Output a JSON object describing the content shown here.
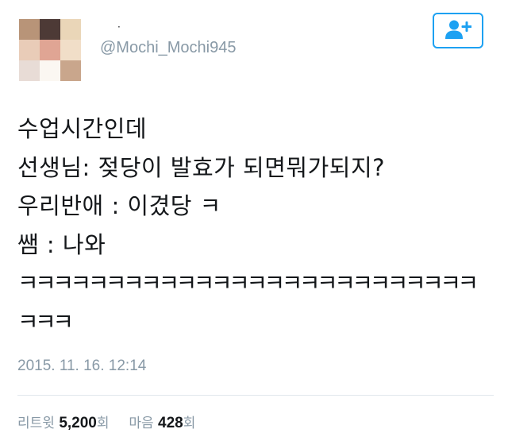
{
  "author": {
    "display_name": "·",
    "handle": "@Mochi_Mochi945",
    "avatar_colors": [
      "#b89478",
      "#4d3a36",
      "#ead6b8",
      "#e9ccb8",
      "#e0a594",
      "#f1dec8",
      "#e8dcd6",
      "#fbf7f2",
      "#c9a68c"
    ]
  },
  "follow_button": {
    "icon": "follow-user-plus-icon",
    "color": "#1da1f2"
  },
  "tweet": {
    "lines": [
      "수업시간인데",
      "선생님: 젖당이 발효가 되면뭐가되지?",
      "우리반애 : 이겼당 ㅋ",
      "쌤 : 나와",
      "ㅋㅋㅋㅋㅋㅋㅋㅋㅋㅋㅋㅋㅋㅋㅋㅋㅋㅋㅋㅋㅋㅋㅋㅋㅋㅋ",
      "ㅋㅋㅋ"
    ],
    "timestamp": "2015. 11. 16. 12:14"
  },
  "stats": {
    "retweets_label": "리트윗",
    "retweets_count": "5,200",
    "retweets_unit": "회",
    "likes_label": "마음",
    "likes_count": "428",
    "likes_unit": "회"
  }
}
